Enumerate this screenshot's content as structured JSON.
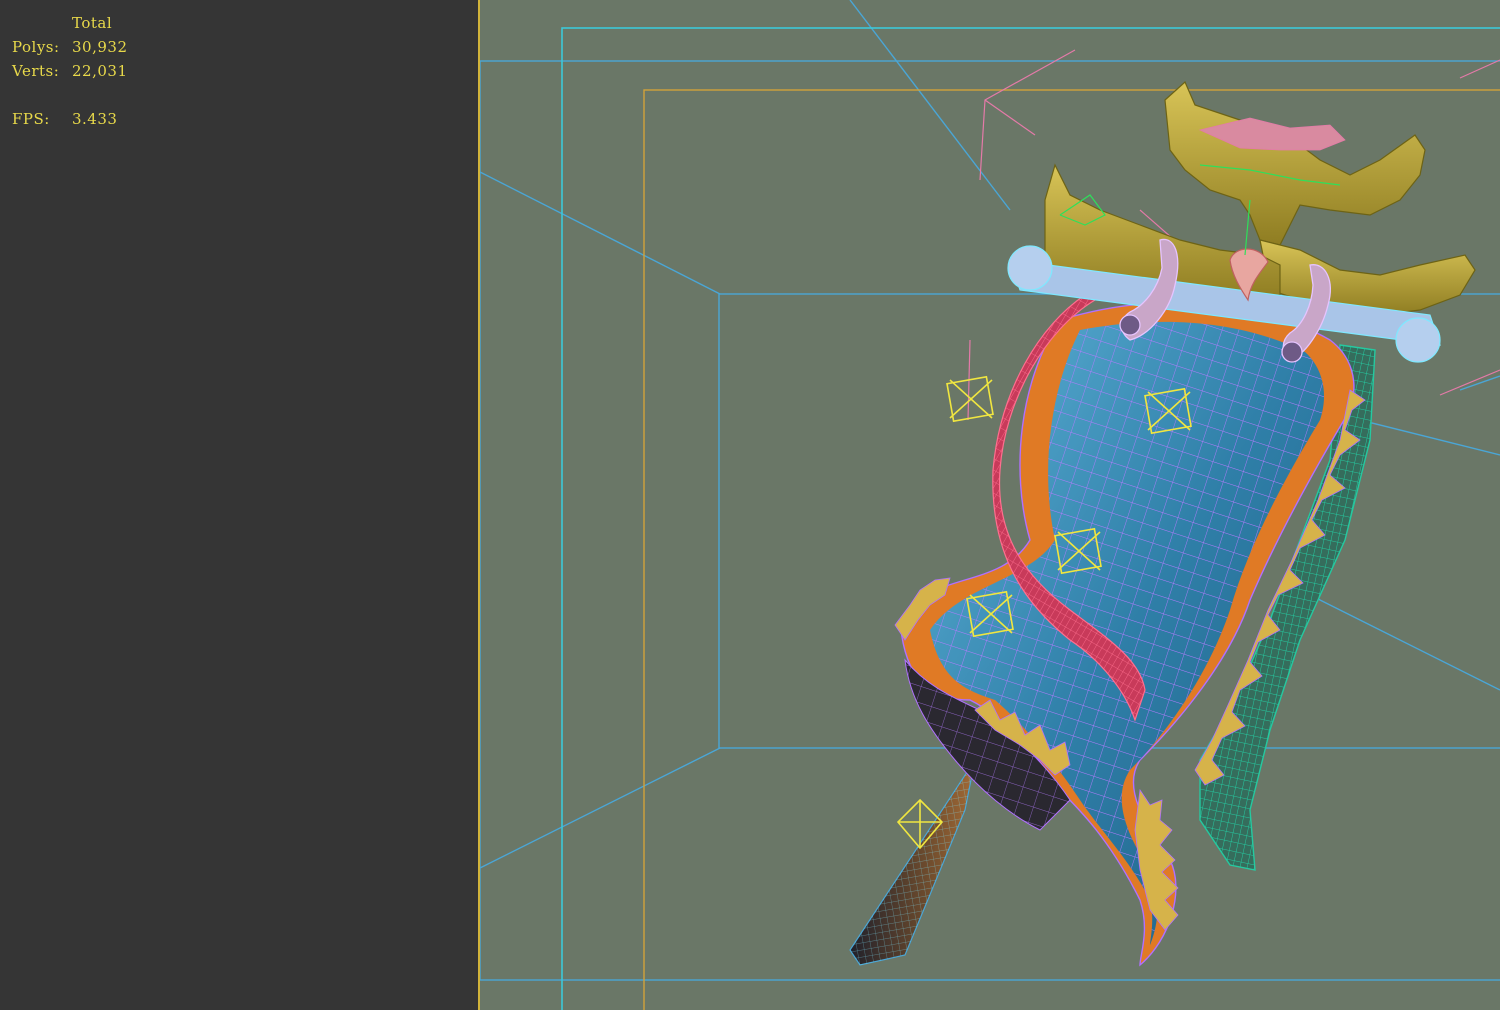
{
  "stats": {
    "title": "Total",
    "polys_label": "Polys:",
    "polys_value": "30,932",
    "verts_label": "Verts:",
    "verts_value": "22,031",
    "fps_label": "FPS:",
    "fps_value": "3.433"
  },
  "colors": {
    "panel_bg": "#353535",
    "viewport_bg": "#6a7767",
    "stat_text": "#e8d94a",
    "safe_frame_cyan": "#3cc8d8",
    "safe_frame_orange": "#d2a23a",
    "wire_purple": "#b070ff",
    "cloth_blue": "#3d8fb8",
    "trim_orange": "#e07a25",
    "gold": "#b8a535",
    "ribbon_red": "#c83a5a",
    "wire_green": "#25c9a0"
  },
  "icons": [
    "helper-box-icon",
    "helper-point-icon"
  ]
}
